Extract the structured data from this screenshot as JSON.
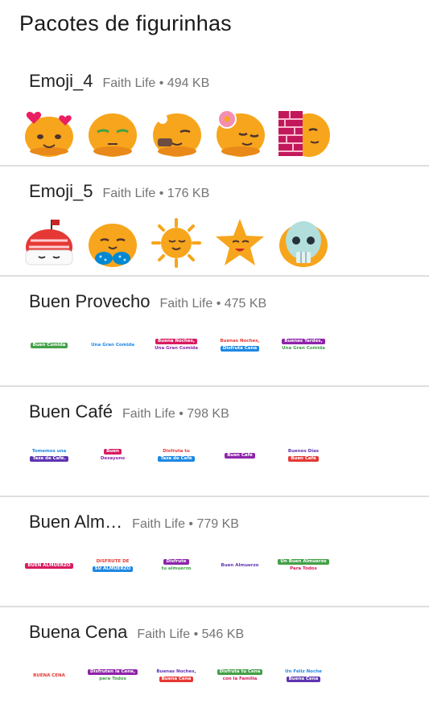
{
  "page": {
    "title": "Pacotes de figurinhas"
  },
  "packs": [
    {
      "name": "Emoji_4",
      "meta": "Faith Life • 494 KB",
      "stickers": [
        "hearts-emoji-icon",
        "tired-emoji-icon",
        "cookie-eating-emoji-icon",
        "donut-emoji-icon",
        "brick-wall-emoji-icon"
      ]
    },
    {
      "name": "Emoji_5",
      "meta": "Faith Life • 176 KB",
      "stickers": [
        "sushi-emoji-icon",
        "bikini-emoji-icon",
        "sun-emoji-icon",
        "star-emoji-icon",
        "skull-emoji-icon"
      ]
    },
    {
      "name": "Buen Provecho",
      "meta": "Faith Life • 475 KB",
      "text_stickers": [
        [
          "Buen Comida"
        ],
        [
          "Una Gran Comida"
        ],
        [
          "Buena Noches,",
          "Una Gran Comida"
        ],
        [
          "Buenas Noches,",
          "Disfruta Cena"
        ],
        [
          "Buenas Tardes,",
          "Una Gran Comida"
        ]
      ]
    },
    {
      "name": "Buen Café",
      "meta": "Faith Life • 798 KB",
      "text_stickers": [
        [
          "Tomemos una",
          "Taza de Café."
        ],
        [
          "Buen",
          "Desayuno"
        ],
        [
          "Disfruta tu",
          "Taza de Café"
        ],
        [
          "Buen Café"
        ],
        [
          "Buenos Días",
          "Buen Café"
        ]
      ]
    },
    {
      "name": "Buen Alm…",
      "meta": "Faith Life • 779 KB",
      "text_stickers": [
        [
          "BUEN ALMUERZO"
        ],
        [
          "DISFRUTE DE",
          "SU ALMUERZO"
        ],
        [
          "Disfrute",
          "tu almuerzo"
        ],
        [
          "Buen Almuerzo"
        ],
        [
          "Un Buen Almuerzo",
          "Para Todos"
        ]
      ]
    },
    {
      "name": "Buena Cena",
      "meta": "Faith Life • 546 KB",
      "text_stickers": [
        [
          "BUENA CENA"
        ],
        [
          "Disfruten la Cena,",
          "para Todos"
        ],
        [
          "Buenas Noches,",
          "Buena Cena"
        ],
        [
          "Disfruta tu Cena",
          "con la Familia"
        ],
        [
          "Un Feliz Noche",
          "Buena Cena"
        ]
      ]
    }
  ],
  "colors": {
    "emoji_face": "#f7a51c",
    "emoji_face_dark": "#e8891a",
    "divider": "#dedede",
    "meta_text": "#757575",
    "text_sticker_palette": [
      "#8e24aa",
      "#e53935",
      "#43a047",
      "#5e35b1",
      "#d81b60",
      "#1e88e5"
    ]
  }
}
